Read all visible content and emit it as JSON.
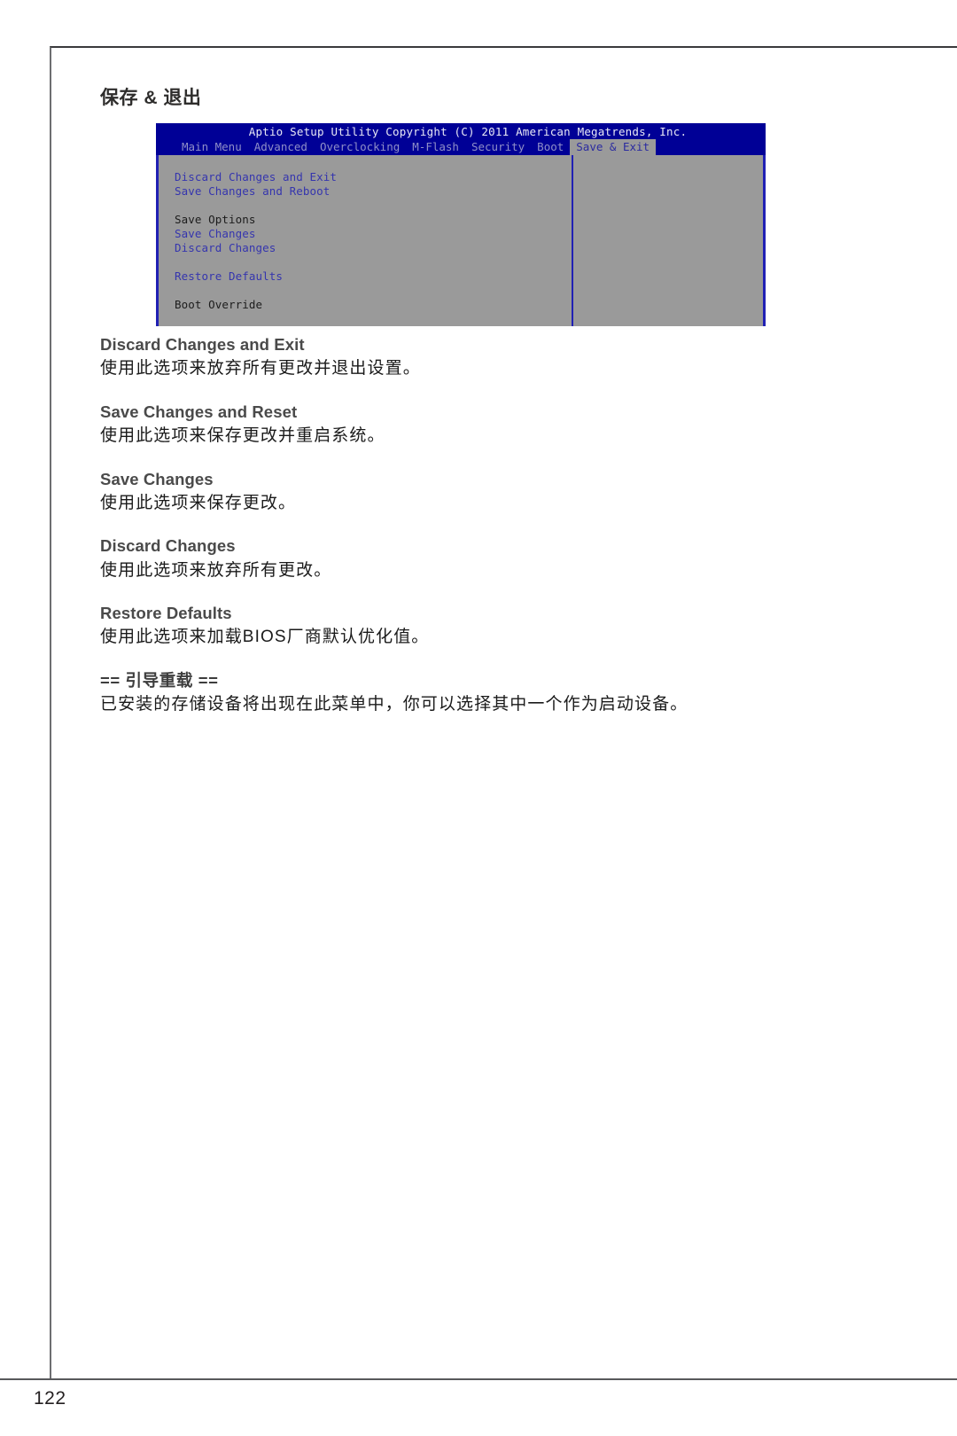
{
  "page": {
    "number": "122",
    "section_title": "保存 & 退出"
  },
  "bios": {
    "title": "Aptio Setup Utility   Copyright (C) 2011 American Megatrends, Inc.",
    "tabs": [
      {
        "label": "Main Menu",
        "active": false
      },
      {
        "label": "Advanced",
        "active": false
      },
      {
        "label": "Overclocking",
        "active": false
      },
      {
        "label": "M-Flash",
        "active": false
      },
      {
        "label": "Security",
        "active": false
      },
      {
        "label": "Boot",
        "active": false
      },
      {
        "label": "Save & Exit",
        "active": true
      }
    ],
    "menu_items": [
      {
        "label": "Discard Changes and Exit",
        "kind": "option"
      },
      {
        "label": "Save Changes and Reboot",
        "kind": "option"
      },
      {
        "label": "",
        "kind": "spacer"
      },
      {
        "label": "Save Options",
        "kind": "header"
      },
      {
        "label": "Save Changes",
        "kind": "option"
      },
      {
        "label": "Discard Changes",
        "kind": "option"
      },
      {
        "label": "",
        "kind": "spacer"
      },
      {
        "label": "Restore Defaults",
        "kind": "option"
      },
      {
        "label": "",
        "kind": "spacer"
      },
      {
        "label": "Boot Override",
        "kind": "header"
      }
    ],
    "colors": {
      "header_blue": "#000096",
      "panel_gray": "#9a9a9a",
      "border_blue": "#2020b4",
      "option_blue": "#3535ae"
    }
  },
  "descriptions": [
    {
      "title": "Discard Changes and Exit",
      "text": "使用此选项来放弃所有更改并退出设置。"
    },
    {
      "title": "Save Changes and Reset",
      "text": "使用此选项来保存更改并重启系统。"
    },
    {
      "title": "Save Changes",
      "text": "使用此选项来保存更改。"
    },
    {
      "title": "Discard Changes",
      "text": "使用此选项来放弃所有更改。"
    },
    {
      "title": "Restore Defaults",
      "text": "使用此选项来加载BIOS厂商默认优化值。"
    },
    {
      "title": "== 引导重载 ==",
      "text": "已安装的存储设备将出现在此菜单中，你可以选择其中一个作为启动设备。",
      "chinese_title": true
    }
  ]
}
